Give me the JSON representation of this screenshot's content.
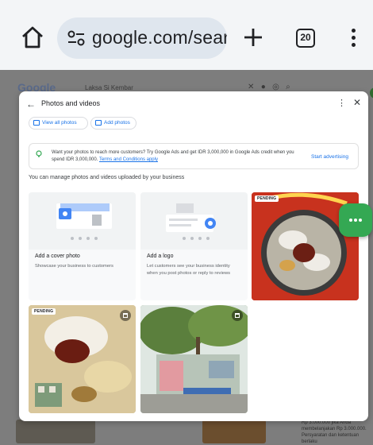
{
  "browser": {
    "url": "google.com/searc",
    "tab_count": "20"
  },
  "background": {
    "logo": "Google",
    "query": "Laksa Si Kembar",
    "side_text": "Rp 3.000.000 jika Anda membelanjakan Rp 3.000.000. Persyaratan dan ketentuan berlaku"
  },
  "dialog": {
    "title": "Photos and videos",
    "chips": {
      "view_all": "View all photos",
      "add": "Add photos"
    },
    "promo": {
      "text": "Want your photos to reach more customers? Try Google Ads and get IDR 3,000,000 in Google Ads credit when you spend IDR 3,000,000.",
      "link": "Terms and Conditions apply",
      "cta": "Start advertising"
    },
    "manage_text": "You can manage photos and videos uploaded by your business",
    "cards": {
      "cover": {
        "title": "Add a cover photo",
        "desc": "Showcase your business to customers"
      },
      "logo": {
        "title": "Add a logo",
        "desc": "Let customers see your business identity when you post photos or reply to reviews"
      }
    },
    "photo_badge": "PENDING"
  },
  "colors": {
    "accent": "#1a73e8",
    "fab": "#34a853",
    "photo_red": "#c8321e"
  }
}
